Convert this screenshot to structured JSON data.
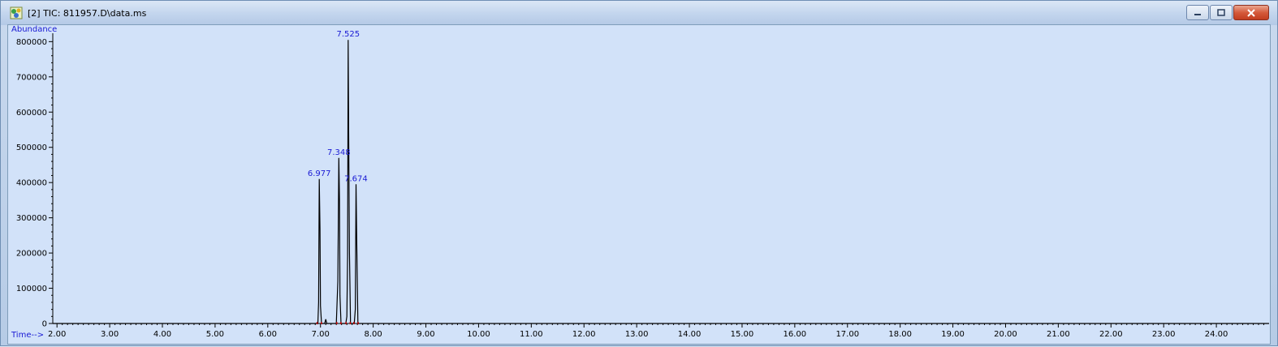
{
  "window": {
    "title": "[2] TIC: 811957.D\\data.ms",
    "title_icon": "chromatogram-app-icon",
    "controls": [
      "minimize-icon",
      "maximize-icon",
      "close-icon"
    ]
  },
  "colors": {
    "plot_background": "#d2e2f9",
    "trace": "#000000",
    "label": "#1a1ad4",
    "baseline_marker": "#c00000"
  },
  "chart_data": {
    "type": "line",
    "title": "",
    "xlabel": "Time-->",
    "ylabel": "Abundance",
    "xlim": [
      1.92,
      25.0
    ],
    "ylim": [
      0,
      810000
    ],
    "grid": false,
    "x_ticks": [
      2.0,
      3.0,
      4.0,
      5.0,
      6.0,
      7.0,
      8.0,
      9.0,
      10.0,
      11.0,
      12.0,
      13.0,
      14.0,
      15.0,
      16.0,
      17.0,
      18.0,
      19.0,
      20.0,
      21.0,
      22.0,
      23.0,
      24.0
    ],
    "x_tick_labels": [
      "2.00",
      "3.00",
      "4.00",
      "5.00",
      "6.00",
      "7.00",
      "8.00",
      "9.00",
      "10.00",
      "11.00",
      "12.00",
      "13.00",
      "14.00",
      "15.00",
      "16.00",
      "17.00",
      "18.00",
      "19.00",
      "20.00",
      "21.00",
      "22.00",
      "23.00",
      "24.00"
    ],
    "y_ticks": [
      0,
      100000,
      200000,
      300000,
      400000,
      500000,
      600000,
      700000,
      800000
    ],
    "y_tick_labels": [
      "0",
      "100000",
      "200000",
      "300000",
      "400000",
      "500000",
      "600000",
      "700000",
      "800000"
    ],
    "peaks": [
      {
        "rt": 6.977,
        "label": "6.977",
        "abundance": 410000
      },
      {
        "rt": 7.348,
        "label": "7.348",
        "abundance": 470000
      },
      {
        "rt": 7.525,
        "label": "7.525",
        "abundance": 805000
      },
      {
        "rt": 7.674,
        "label": "7.674",
        "abundance": 395000
      }
    ],
    "series": [
      {
        "x": [
          1.92,
          6.5,
          6.95,
          6.965,
          6.977,
          6.99,
          7.0,
          7.02,
          7.08,
          7.1,
          7.12,
          7.3,
          7.33,
          7.348,
          7.36,
          7.37,
          7.39,
          7.48,
          7.5,
          7.515,
          7.525,
          7.535,
          7.55,
          7.57,
          7.64,
          7.66,
          7.674,
          7.69,
          7.71,
          7.78,
          8.5,
          12.0,
          18.0,
          25.0
        ],
        "y": [
          0,
          0,
          0,
          60000,
          410000,
          270000,
          50000,
          0,
          0,
          12000,
          0,
          0,
          120000,
          470000,
          350000,
          80000,
          0,
          0,
          20000,
          190000,
          805000,
          550000,
          200000,
          0,
          0,
          40000,
          395000,
          210000,
          0,
          0,
          0,
          0,
          0,
          0
        ]
      }
    ]
  }
}
